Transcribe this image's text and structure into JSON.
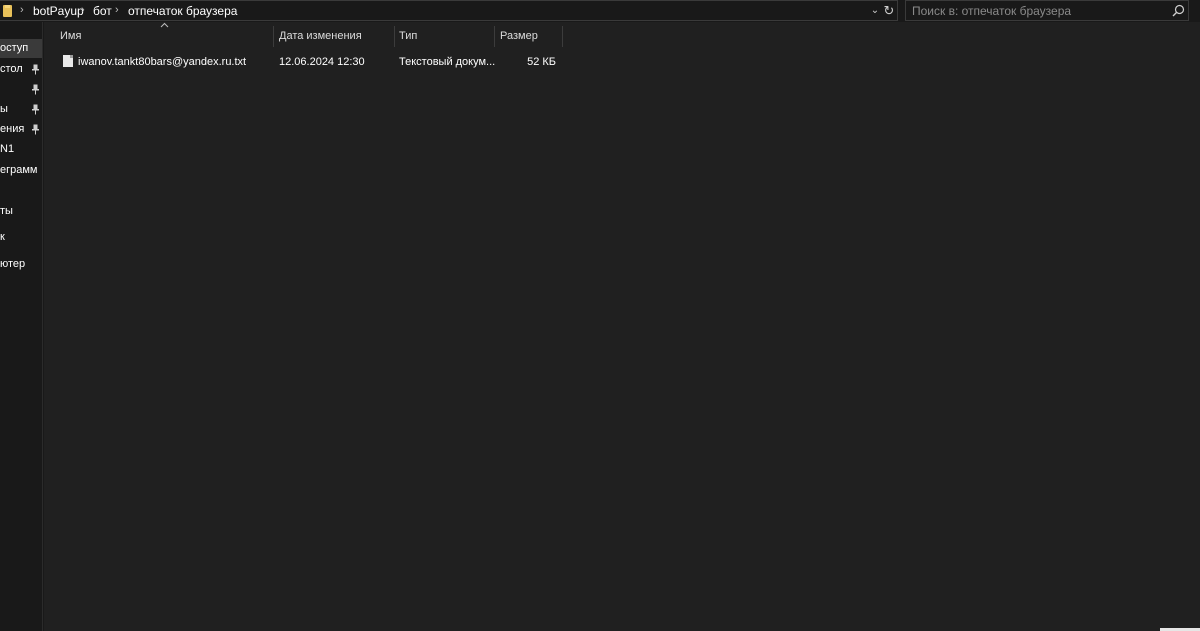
{
  "address_bar": {
    "breadcrumbs": [
      "botPayup",
      "бот",
      "отпечаток браузера"
    ]
  },
  "search": {
    "placeholder": "Поиск в: отпечаток браузера"
  },
  "nav": {
    "items": [
      {
        "label": "оступ",
        "pinned": false,
        "selected": true
      },
      {
        "label": "стол",
        "pinned": true,
        "selected": false
      },
      {
        "label": "",
        "pinned": true,
        "selected": false
      },
      {
        "label": "ы",
        "pinned": true,
        "selected": false
      },
      {
        "label": "ения",
        "pinned": true,
        "selected": false
      },
      {
        "label": "N1",
        "pinned": false,
        "selected": false
      },
      {
        "label": "еграмм",
        "pinned": false,
        "selected": false
      },
      {
        "label": "ты",
        "pinned": false,
        "selected": false
      },
      {
        "label": "к",
        "pinned": false,
        "selected": false
      },
      {
        "label": "ютер",
        "pinned": false,
        "selected": false
      }
    ]
  },
  "columns": {
    "name": "Имя",
    "date": "Дата изменения",
    "type": "Тип",
    "size": "Размер"
  },
  "files": [
    {
      "name": "iwanov.tankt80bars@yandex.ru.txt",
      "date": "12.06.2024 12:30",
      "type": "Текстовый докум...",
      "size": "52 КБ"
    }
  ],
  "icons": {
    "folder": "folder-icon",
    "search": "search-icon",
    "pin": "pin-icon",
    "file": "text-file-icon",
    "refresh": "refresh-icon",
    "dropdown": "chevron-down-icon",
    "sort": "sort-ascending-icon"
  },
  "colors": {
    "background": "#191919",
    "content_background": "#202020",
    "selection": "#3a3a3a",
    "folder_yellow": "#e8c15a"
  }
}
